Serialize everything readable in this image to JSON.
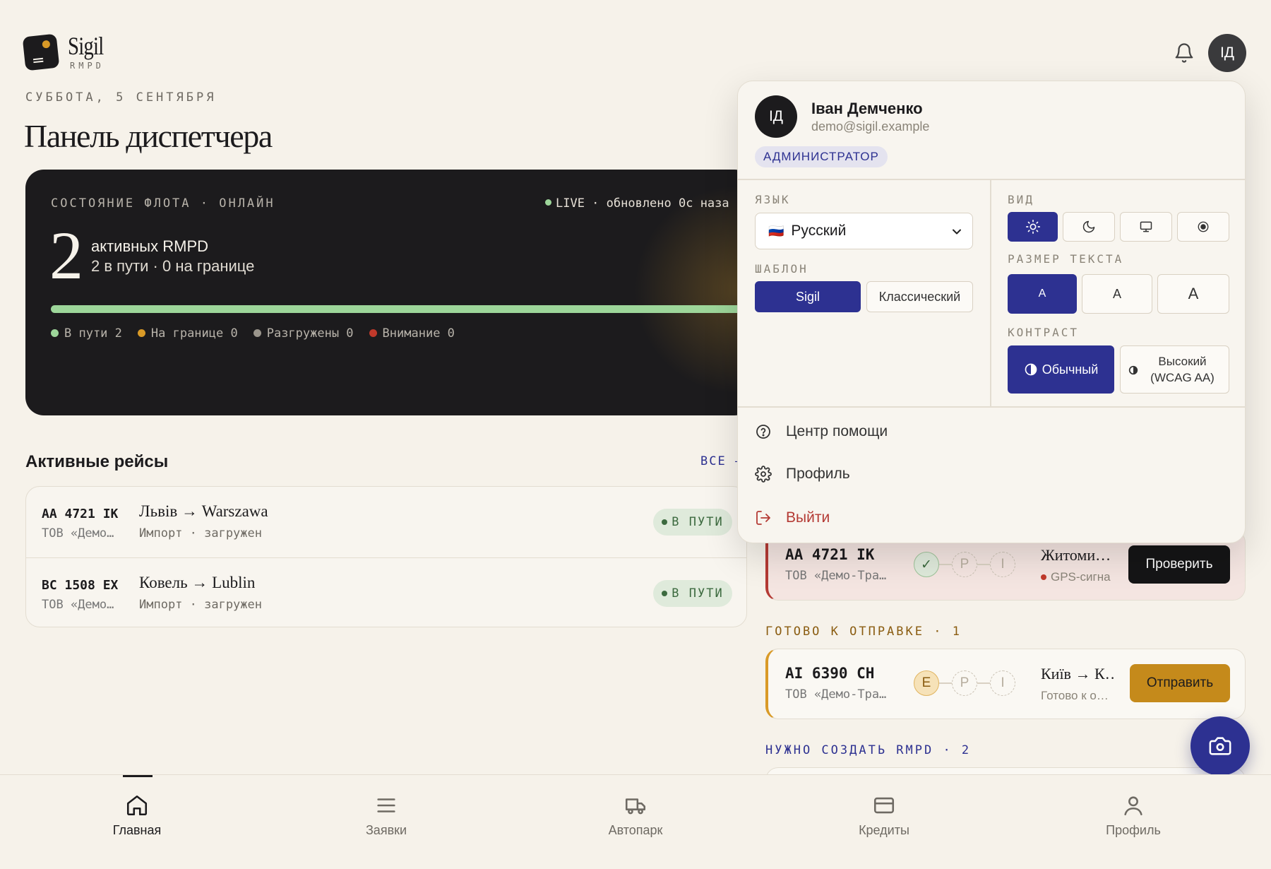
{
  "brand": {
    "name": "Sigil",
    "sub": "RMPD"
  },
  "header": {
    "date": "СУББОТА, 5 СЕНТЯБРЯ",
    "title": "Панель диспетчера",
    "avatar": "ІД"
  },
  "hero": {
    "label": "СОСТОЯНИЕ ФЛОТА · ОНЛАЙН",
    "live": "LIVE · обновлено 0с наза",
    "count": "2",
    "count_label": "активных RMPD",
    "count_sub": "2 в пути · 0 на границе",
    "progress": 1.0,
    "legend": [
      {
        "label": "В пути 2",
        "color": "#9dd69a"
      },
      {
        "label": "На границе 0",
        "color": "#d99a27"
      },
      {
        "label": "Разгружены 0",
        "color": "#9a958c"
      },
      {
        "label": "Внимание 0",
        "color": "#c0392b"
      }
    ]
  },
  "active": {
    "title": "Активные рейсы",
    "all_link": "ВСЕ —",
    "rows": [
      {
        "plate": "AA 4721 IK",
        "company": "ТОВ «Демо…",
        "route": "Львів → Warszawa",
        "sub": "Импорт · загружен",
        "status": "В ПУТИ"
      },
      {
        "plate": "BC 1508 EX",
        "company": "ТОВ «Демо…",
        "route": "Ковель → Lublin",
        "sub": "Импорт · загружен",
        "status": "В ПУТИ"
      }
    ]
  },
  "queue": {
    "attention": {
      "plate": "AA 4721 IK",
      "company": "ТОВ «Демо-Тра…",
      "steps": [
        "✓",
        "P",
        "I"
      ],
      "city": "Житоми…",
      "note": "GPS-сигна",
      "action": "Проверить"
    },
    "ready_label": "ГОТОВО К ОТПРАВКЕ · 1",
    "ready": {
      "plate": "AI 6390 CH",
      "company": "ТОВ «Демо-Тра…",
      "steps": [
        "E",
        "P",
        "I"
      ],
      "city": "Київ → К…",
      "note": "Готово к о…",
      "action": "Отправить"
    },
    "create_label": "НУЖНО СОЗДАТЬ RMPD · 2"
  },
  "menu": {
    "avatar": "ІД",
    "name": "Іван Демченко",
    "email": "demo@sigil.example",
    "role": "АДМИНИСТРАТОР",
    "language_label": "ЯЗЫК",
    "language_flag": "🇷🇺",
    "language_value": "Русский",
    "template_label": "ШАБЛОН",
    "templates": [
      "Sigil",
      "Классический"
    ],
    "template_selected": "Sigil",
    "view_label": "ВИД",
    "view_modes": [
      "light",
      "dark",
      "system",
      "high-contrast"
    ],
    "view_selected": "light",
    "text_size_label": "РАЗМЕР ТЕКСТА",
    "text_sizes": [
      "A",
      "A",
      "A"
    ],
    "text_size_selected": 0,
    "contrast_label": "КОНТРАСТ",
    "contrast_normal": "Обычный",
    "contrast_high": "Высокий (WCAG AA)",
    "contrast_selected": "normal",
    "items": [
      "Центр помощи",
      "Профиль",
      "Выйти"
    ]
  },
  "nav": {
    "items": [
      "Главная",
      "Заявки",
      "Автопарк",
      "Кредиты",
      "Профиль"
    ],
    "active": "Главная"
  },
  "colors": {
    "accent": "#2d3191",
    "amber": "#c58a1b",
    "danger": "#b43a34",
    "bg": "#f6f2ea",
    "dark": "#1c1b1d"
  }
}
